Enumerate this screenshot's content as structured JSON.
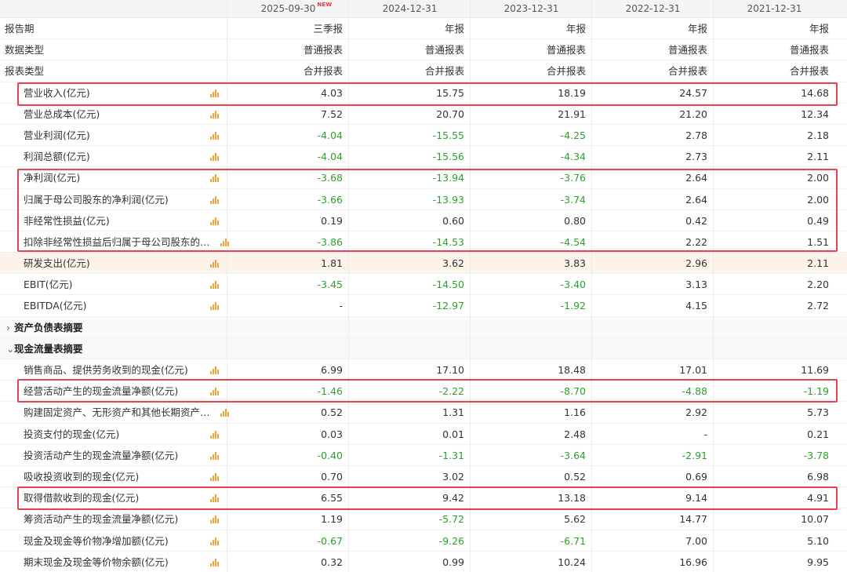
{
  "header": {
    "columns": [
      "2025-09-30",
      "2024-12-31",
      "2023-12-31",
      "2022-12-31",
      "2021-12-31"
    ],
    "new_badge": "NEW"
  },
  "colors": {
    "negative": "#2ca02c",
    "highlight": "#e8444f",
    "chart_icon": "#f0a43c",
    "alt_row": "#fcf4ea"
  },
  "rows": [
    {
      "label": "报告期",
      "type": "meta",
      "values": [
        "三季报",
        "年报",
        "年报",
        "年报",
        "年报"
      ]
    },
    {
      "label": "数据类型",
      "type": "meta",
      "values": [
        "普通报表",
        "普通报表",
        "普通报表",
        "普通报表",
        "普通报表"
      ]
    },
    {
      "label": "报表类型",
      "type": "meta",
      "values": [
        "合并报表",
        "合并报表",
        "合并报表",
        "合并报表",
        "合并报表"
      ]
    },
    {
      "label": "营业收入(亿元)",
      "type": "data",
      "values": [
        "4.03",
        "15.75",
        "18.19",
        "24.57",
        "14.68"
      ]
    },
    {
      "label": "营业总成本(亿元)",
      "type": "data",
      "values": [
        "7.52",
        "20.70",
        "21.91",
        "21.20",
        "12.34"
      ]
    },
    {
      "label": "营业利润(亿元)",
      "type": "data",
      "values": [
        "-4.04",
        "-15.55",
        "-4.25",
        "2.78",
        "2.18"
      ]
    },
    {
      "label": "利润总额(亿元)",
      "type": "data",
      "values": [
        "-4.04",
        "-15.56",
        "-4.34",
        "2.73",
        "2.11"
      ]
    },
    {
      "label": "净利润(亿元)",
      "type": "data",
      "values": [
        "-3.68",
        "-13.94",
        "-3.76",
        "2.64",
        "2.00"
      ]
    },
    {
      "label": "归属于母公司股东的净利润(亿元)",
      "type": "data",
      "values": [
        "-3.66",
        "-13.93",
        "-3.74",
        "2.64",
        "2.00"
      ]
    },
    {
      "label": "非经常性损益(亿元)",
      "type": "data",
      "values": [
        "0.19",
        "0.60",
        "0.80",
        "0.42",
        "0.49"
      ]
    },
    {
      "label": "扣除非经常性损益后归属于母公司股东的…",
      "type": "data",
      "wide": true,
      "values": [
        "-3.86",
        "-14.53",
        "-4.54",
        "2.22",
        "1.51"
      ]
    },
    {
      "label": "研发支出(亿元)",
      "type": "data",
      "alt": true,
      "values": [
        "1.81",
        "3.62",
        "3.83",
        "2.96",
        "2.11"
      ]
    },
    {
      "label": "EBIT(亿元)",
      "type": "data",
      "values": [
        "-3.45",
        "-14.50",
        "-3.40",
        "3.13",
        "2.20"
      ]
    },
    {
      "label": "EBITDA(亿元)",
      "type": "data",
      "values": [
        "-",
        "-12.97",
        "-1.92",
        "4.15",
        "2.72"
      ]
    },
    {
      "label": "资产负债表摘要",
      "type": "section",
      "chevron": "›"
    },
    {
      "label": "现金流量表摘要",
      "type": "section",
      "chevron": "⌄"
    },
    {
      "label": "销售商品、提供劳务收到的现金(亿元)",
      "type": "data",
      "values": [
        "6.99",
        "17.10",
        "18.48",
        "17.01",
        "11.69"
      ]
    },
    {
      "label": "经营活动产生的现金流量净额(亿元)",
      "type": "data",
      "values": [
        "-1.46",
        "-2.22",
        "-8.70",
        "-4.88",
        "-1.19"
      ]
    },
    {
      "label": "购建固定资产、无形资产和其他长期资产…",
      "type": "data",
      "wide": true,
      "values": [
        "0.52",
        "1.31",
        "1.16",
        "2.92",
        "5.73"
      ]
    },
    {
      "label": "投资支付的现金(亿元)",
      "type": "data",
      "values": [
        "0.03",
        "0.01",
        "2.48",
        "-",
        "0.21"
      ]
    },
    {
      "label": "投资活动产生的现金流量净额(亿元)",
      "type": "data",
      "values": [
        "-0.40",
        "-1.31",
        "-3.64",
        "-2.91",
        "-3.78"
      ]
    },
    {
      "label": "吸收投资收到的现金(亿元)",
      "type": "data",
      "values": [
        "0.70",
        "3.02",
        "0.52",
        "0.69",
        "6.98"
      ]
    },
    {
      "label": "取得借款收到的现金(亿元)",
      "type": "data",
      "values": [
        "6.55",
        "9.42",
        "13.18",
        "9.14",
        "4.91"
      ]
    },
    {
      "label": "筹资活动产生的现金流量净额(亿元)",
      "type": "data",
      "values": [
        "1.19",
        "-5.72",
        "5.62",
        "14.77",
        "10.07"
      ]
    },
    {
      "label": "现金及现金等价物净增加额(亿元)",
      "type": "data",
      "values": [
        "-0.67",
        "-9.26",
        "-6.71",
        "7.00",
        "5.10"
      ]
    },
    {
      "label": "期末现金及现金等价物余额(亿元)",
      "type": "data",
      "values": [
        "0.32",
        "0.99",
        "10.24",
        "16.96",
        "9.95"
      ]
    }
  ]
}
